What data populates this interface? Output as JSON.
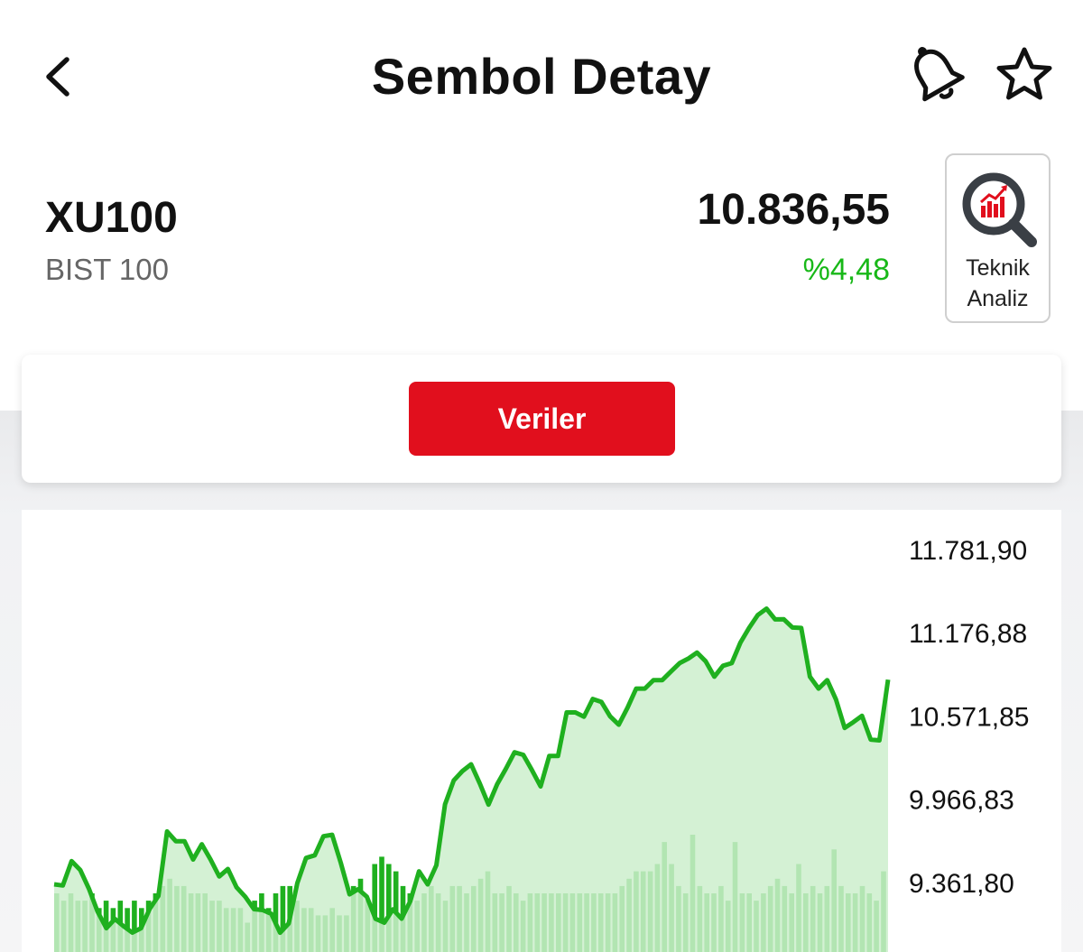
{
  "header": {
    "title": "Sembol Detay",
    "back_icon": "chevron-left-icon",
    "bell_icon": "bell-icon",
    "star_icon": "star-icon"
  },
  "symbol": {
    "code": "XU100",
    "name": "BIST 100",
    "price": "10.836,55",
    "change": "%4,48",
    "change_color": "#18b818"
  },
  "technical_analysis": {
    "line1": "Teknik",
    "line2": "Analiz",
    "icon": "chart-magnifier-icon",
    "accent": "#e10f1d"
  },
  "data_button": {
    "label": "Veriler",
    "color": "#e10f1d"
  },
  "chart_data": {
    "type": "area",
    "color": "#1fb01f",
    "fill": "#cdeecd",
    "y_ticks": [
      "11.781,90",
      "11.176,88",
      "10.571,85",
      "9.966,83",
      "9.361,80"
    ],
    "y_tick_values": [
      11781.9,
      11176.88,
      10571.85,
      9966.83,
      9361.8
    ],
    "prices": [
      9349,
      9340,
      9517,
      9453,
      9317,
      9151,
      9030,
      9097,
      9044,
      8998,
      9030,
      9171,
      9264,
      9733,
      9662,
      9662,
      9529,
      9640,
      9529,
      9406,
      9460,
      9327,
      9258,
      9168,
      9162,
      9134,
      8997,
      9064,
      9359,
      9540,
      9560,
      9698,
      9709,
      9505,
      9276,
      9313,
      9258,
      9098,
      9070,
      9167,
      9099,
      9226,
      9443,
      9348,
      9487,
      9930,
      10104,
      10172,
      10221,
      10082,
      9928,
      10077,
      10188,
      10308,
      10290,
      10179,
      10060,
      10281,
      10281,
      10598,
      10598,
      10567,
      10696,
      10674,
      10570,
      10509,
      10632,
      10771,
      10771,
      10833,
      10833,
      10895,
      10956,
      10989,
      11033,
      10970,
      10858,
      10937,
      10956,
      11106,
      11212,
      11306,
      11352,
      11274,
      11275,
      11215,
      11212,
      10858,
      10771,
      10833,
      10692,
      10485,
      10527,
      10574,
      10401,
      10395,
      10836
    ],
    "volumes": [
      8,
      7,
      8,
      7,
      7,
      8,
      6,
      7,
      6,
      7,
      6,
      7,
      6,
      7,
      8,
      9,
      10,
      9,
      9,
      8,
      8,
      8,
      7,
      7,
      6,
      6,
      6,
      4,
      7,
      8,
      6,
      8,
      9,
      9,
      7,
      6,
      6,
      5,
      5,
      6,
      5,
      5,
      9,
      10,
      7,
      12,
      13,
      12,
      11,
      9,
      8,
      7,
      8,
      9,
      8,
      7,
      9,
      9,
      8,
      9,
      10,
      11,
      8,
      8,
      9,
      8,
      7,
      8,
      8,
      8,
      8,
      8,
      8,
      8,
      8,
      8,
      8,
      8,
      8,
      8,
      9,
      10,
      11,
      11,
      11,
      12,
      15,
      12,
      9,
      8,
      16,
      9,
      8,
      8,
      9,
      7,
      15,
      8,
      8,
      7,
      8,
      9,
      10,
      9,
      8,
      12,
      8,
      9,
      8,
      9,
      14,
      9,
      8,
      8,
      9,
      8,
      7,
      11
    ]
  }
}
